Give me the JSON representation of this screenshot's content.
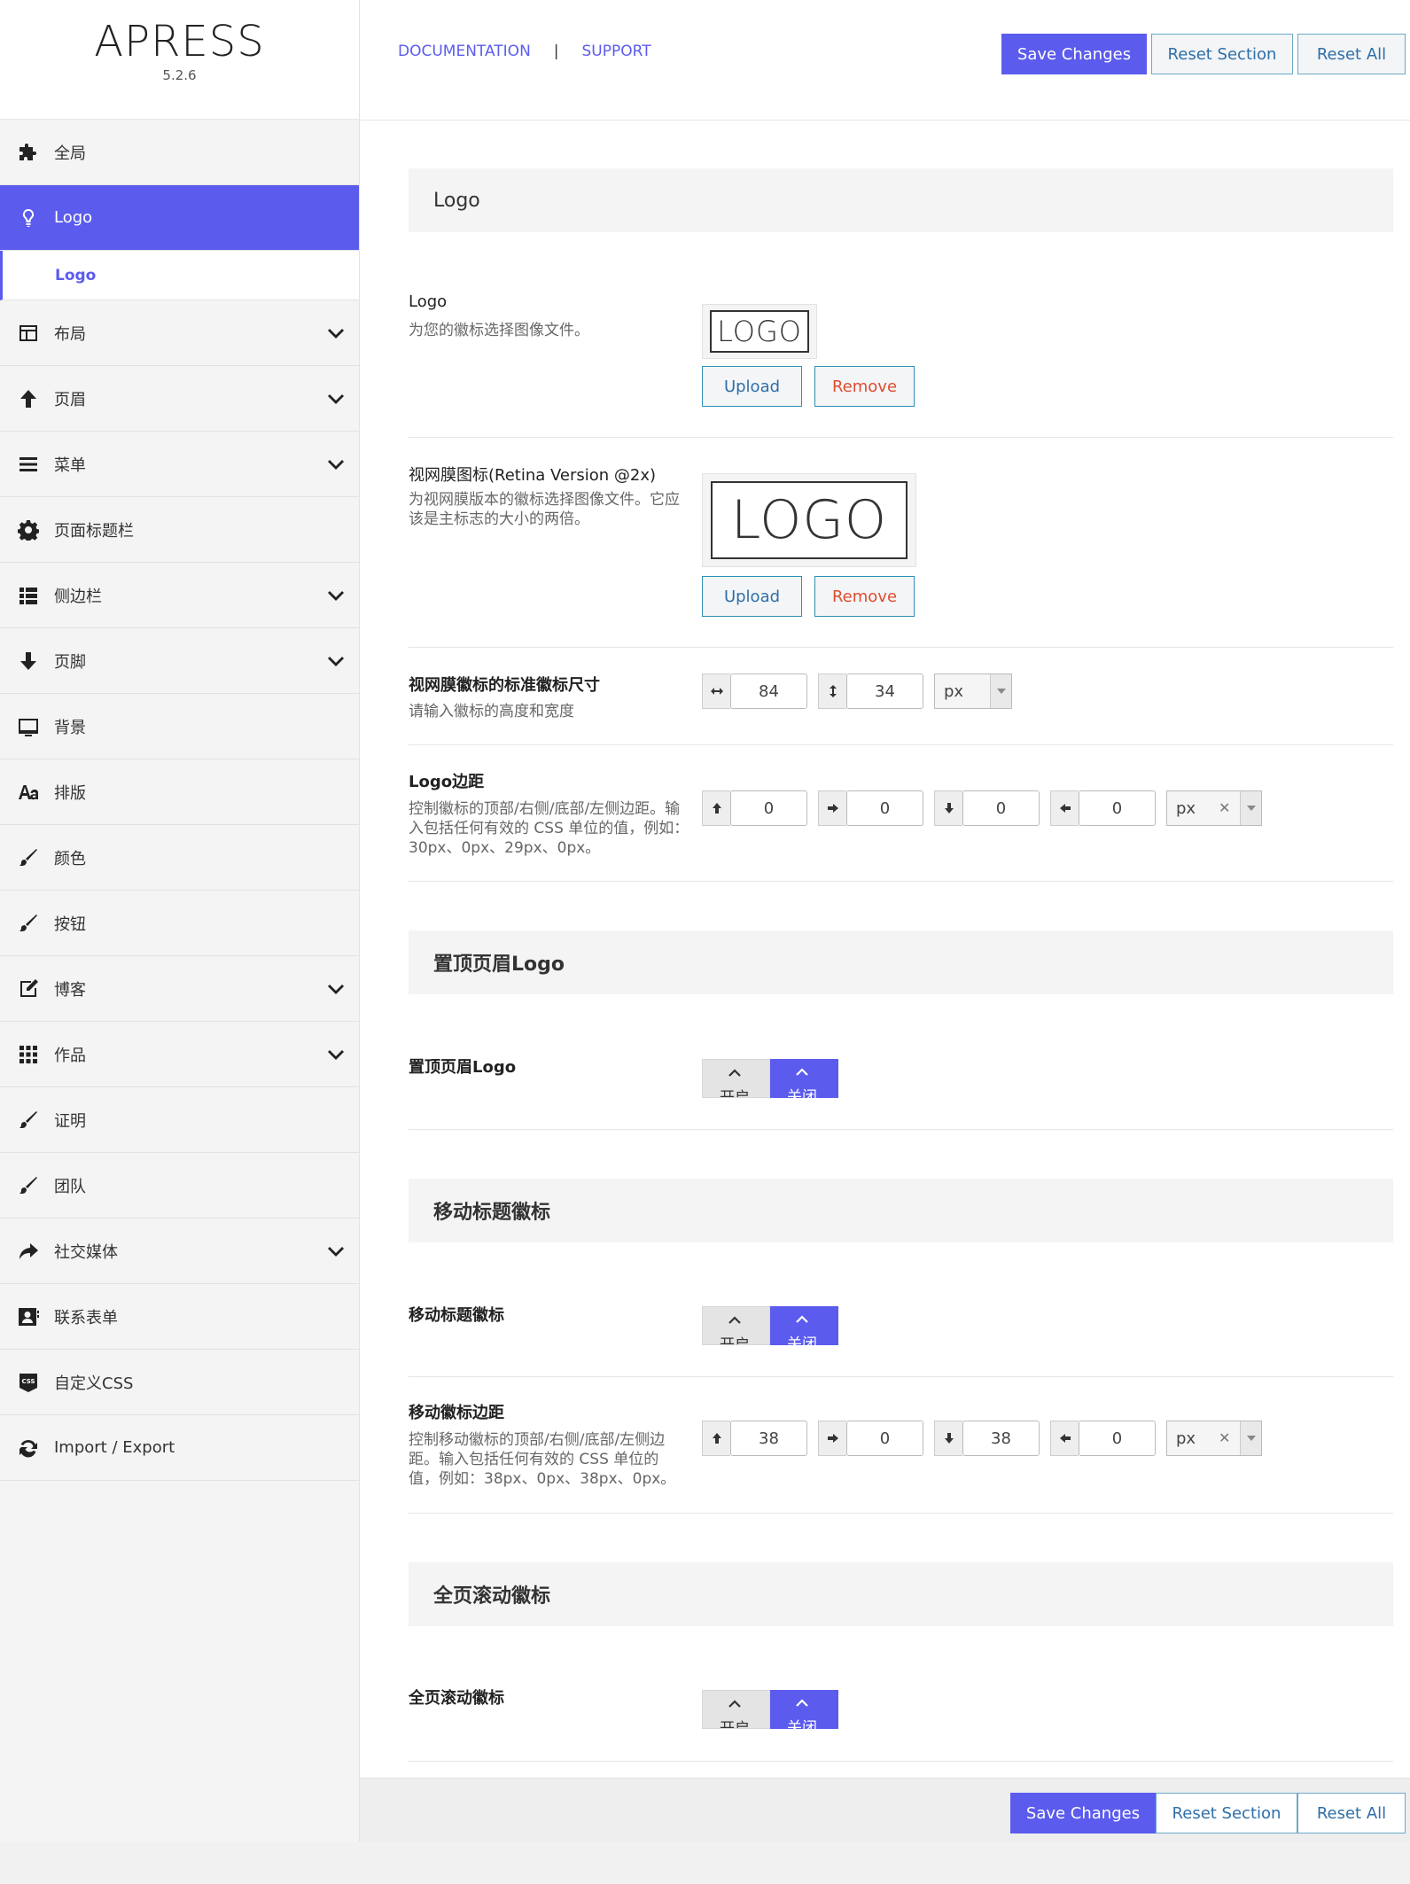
{
  "brand": {
    "title": "APRESS",
    "version": "5.2.6"
  },
  "header": {
    "documentation": "DOCUMENTATION",
    "separator": "|",
    "support": "SUPPORT",
    "save_label": "Save Changes",
    "reset_section_label": "Reset Section",
    "reset_all_label": "Reset All"
  },
  "sidebar": {
    "items": [
      {
        "label": "全局",
        "icon": "puzzle-icon"
      },
      {
        "label": "Logo",
        "icon": "lightbulb-icon"
      },
      {
        "label": "布局",
        "icon": "layout-icon"
      },
      {
        "label": "页眉",
        "icon": "arrow-up-icon"
      },
      {
        "label": "菜单",
        "icon": "menu-icon"
      },
      {
        "label": "页面标题栏",
        "icon": "gear-icon"
      },
      {
        "label": "侧边栏",
        "icon": "list-icon"
      },
      {
        "label": "页脚",
        "icon": "arrow-down-icon"
      },
      {
        "label": "背景",
        "icon": "monitor-icon"
      },
      {
        "label": "排版",
        "icon": "font-icon"
      },
      {
        "label": "颜色",
        "icon": "brush-icon"
      },
      {
        "label": "按钮",
        "icon": "brush-icon"
      },
      {
        "label": "博客",
        "icon": "edit-icon"
      },
      {
        "label": "作品",
        "icon": "grid-icon"
      },
      {
        "label": "证明",
        "icon": "brush-icon"
      },
      {
        "label": "团队",
        "icon": "brush-icon"
      },
      {
        "label": "社交媒体",
        "icon": "share-icon"
      },
      {
        "label": "联系表单",
        "icon": "contact-icon"
      },
      {
        "label": "自定义CSS",
        "icon": "css-icon"
      },
      {
        "label": "Import / Export",
        "icon": "refresh-icon"
      }
    ],
    "sub_item": "Logo"
  },
  "sections": {
    "logo": {
      "heading": "Logo",
      "logo_title": "Logo",
      "logo_desc": "为您的徽标选择图像文件。",
      "logo_preview_text": "LOGO",
      "upload": "Upload",
      "remove": "Remove",
      "retina_title": "视网膜图标(Retina Version @2x)",
      "retina_desc": "为视网膜版本的徽标选择图像文件。它应该是主标志的大小的两倍。",
      "dims_title": "视网膜徽标的标准徽标尺寸",
      "dims_desc": "请输入徽标的高度和宽度",
      "dims_width": "84",
      "dims_height": "34",
      "dims_unit": "px",
      "margin_title": "Logo边距",
      "margin_desc": "控制徽标的顶部/右侧/底部/左侧边距。输入包括任何有效的 CSS 单位的值，例如：30px、0px、29px、0px。",
      "margin_values": [
        "0",
        "0",
        "0",
        "0"
      ],
      "margin_unit": "px"
    },
    "sticky": {
      "heading": "置顶页眉Logo",
      "title": "置顶页眉Logo",
      "on_label": "开启",
      "off_label": "关闭"
    },
    "mobile": {
      "heading": "移动标题徽标",
      "title": "移动标题徽标",
      "on_label": "开启",
      "off_label": "关闭",
      "margin_title": "移动徽标边距",
      "margin_desc": "控制移动徽标的顶部/右侧/底部/左侧边距。输入包括任何有效的 CSS 单位的值，例如：38px、0px、38px、0px。",
      "margin_values": [
        "38",
        "0",
        "38",
        "0"
      ],
      "margin_unit": "px"
    },
    "fullpage": {
      "heading": "全页滚动徽标",
      "title": "全页滚动徽标",
      "on_label": "开启",
      "off_label": "关闭"
    }
  },
  "footer": {
    "save_label": "Save Changes",
    "reset_section_label": "Reset Section",
    "reset_all_label": "Reset All"
  },
  "colors": {
    "accent": "#5b5bee",
    "button_border": "#2f8fb5",
    "remove_text": "#e04b2f"
  }
}
